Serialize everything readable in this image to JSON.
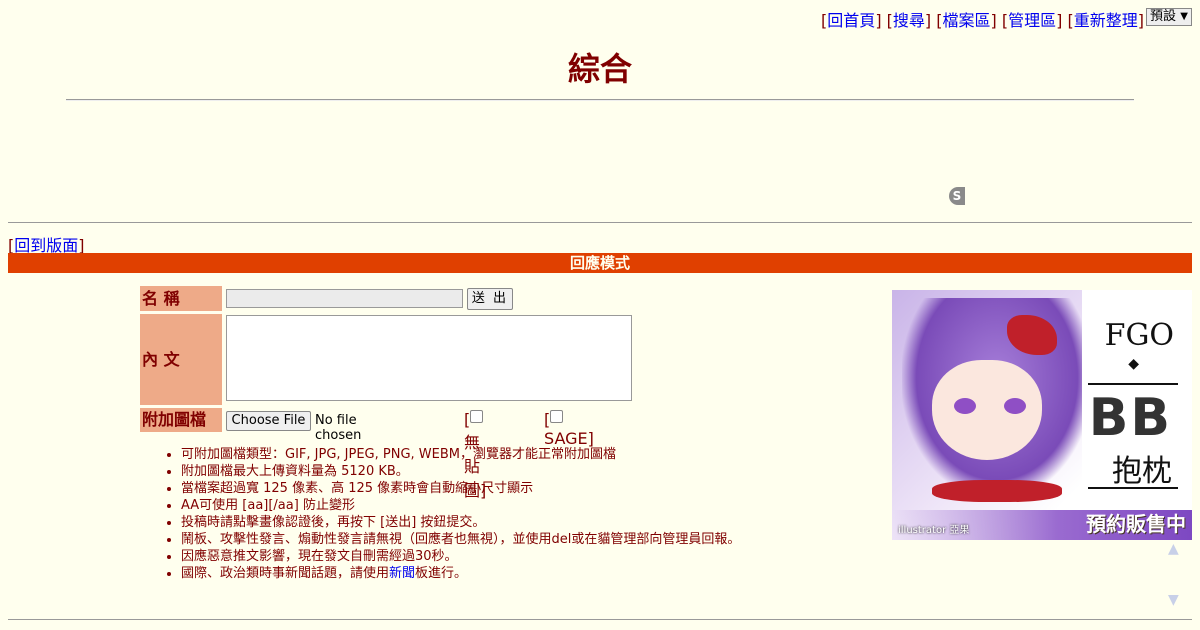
{
  "nav": {
    "links": [
      "回首頁",
      "搜尋",
      "檔案區",
      "管理區",
      "重新整理"
    ],
    "theme_selected": "預設"
  },
  "board": {
    "title": "綜合"
  },
  "back_link": "回到版面",
  "mode_bar": "回應模式",
  "form": {
    "name_label": "名 稱",
    "content_label": "內 文",
    "attach_label": "附加圖檔",
    "send_label": "送 出",
    "choose_file_label": "Choose File",
    "no_file_text": "No file chosen",
    "noimg_label": "無貼圖]",
    "sage_label": "SAGE]"
  },
  "rules": [
    "可附加圖檔類型：GIF, JPG, JPEG, PNG, WEBM，瀏覽器才能正常附加圖檔",
    "附加圖檔最大上傳資料量為 5120 KB。",
    "當檔案超過寬 125 像素、高 125 像素時會自動縮小尺寸顯示",
    "AA可使用 [aa][/aa] 防止變形",
    "投稿時請點擊畫像認證後，再按下 [送出] 按鈕提交。",
    "鬧板、攻擊性發言、煽動性發言請無視（回應者也無視），並使用del或在貓管理部向管理員回報。",
    "因應惡意推文影響，現在發文自刪需經過30秒。"
  ],
  "rule_last": {
    "before": "國際、政治類時事新聞話題，請使用",
    "link": "新聞",
    "after": "板進行。"
  },
  "ad": {
    "line1": "FGO",
    "diamond": "◆",
    "line2": "BB",
    "line3": "抱枕",
    "sale": "預約販售中",
    "illustrator": "illustrator 亞果"
  },
  "badge": "S",
  "scroll": {
    "up": "▲",
    "down": "▼"
  }
}
